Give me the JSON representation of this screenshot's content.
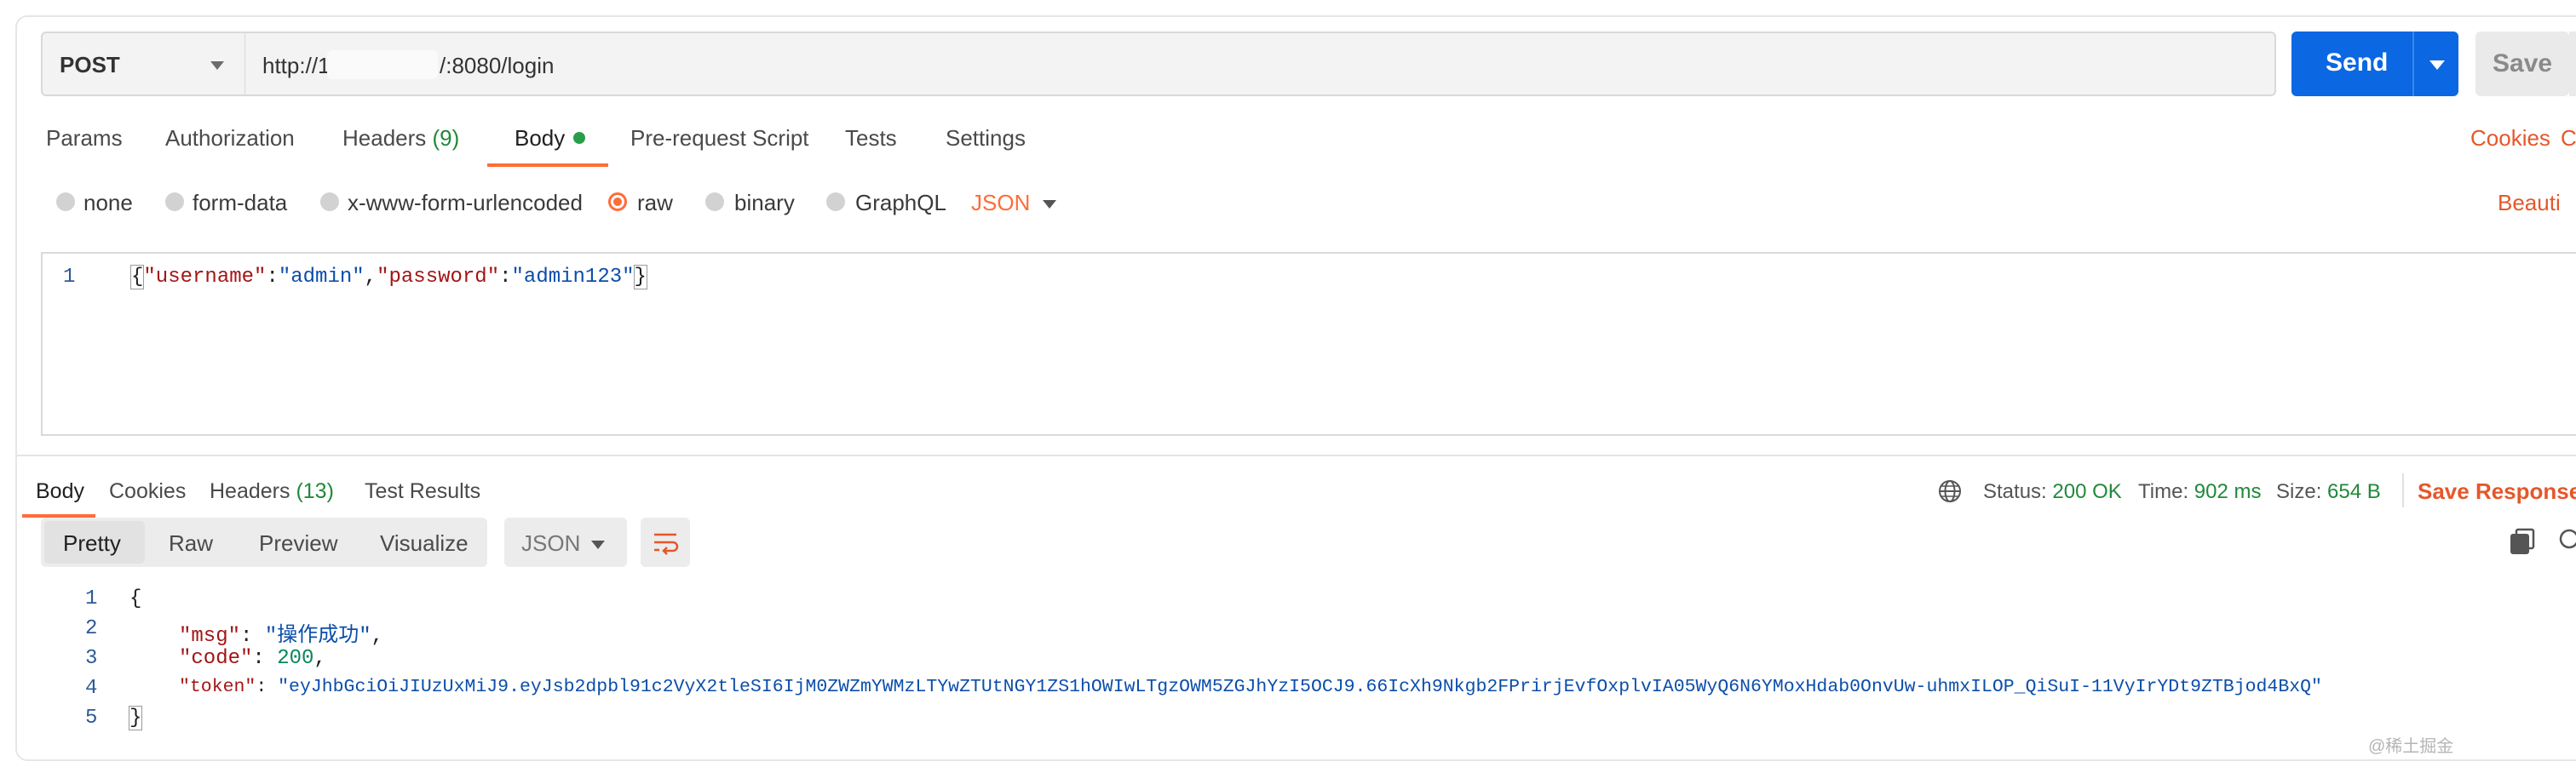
{
  "request": {
    "method": "POST",
    "url_prefix": "http://1",
    "url_suffix": "/:8080/login",
    "send_label": "Send",
    "save_label": "Save"
  },
  "request_tabs": [
    {
      "label": "Params"
    },
    {
      "label": "Authorization"
    },
    {
      "label": "Headers",
      "count": "(9)"
    },
    {
      "label": "Body"
    },
    {
      "label": "Pre-request Script"
    },
    {
      "label": "Tests"
    },
    {
      "label": "Settings"
    }
  ],
  "right_links": {
    "cookies": "Cookies",
    "code_partial": "Co",
    "beautify_partial": "Beauti"
  },
  "body_types": [
    "none",
    "form-data",
    "x-www-form-urlencoded",
    "raw",
    "binary",
    "GraphQL"
  ],
  "body_type_selected": "raw",
  "body_format": "JSON",
  "request_body": {
    "line_number": "1",
    "open": "{",
    "k1": "\"username\"",
    "colon1": ":",
    "v1": "\"admin\"",
    "comma": ",",
    "k2": "\"password\"",
    "colon2": ":",
    "v2": "\"admin123\"",
    "close": "}"
  },
  "response_tabs": [
    {
      "label": "Body"
    },
    {
      "label": "Cookies"
    },
    {
      "label": "Headers",
      "count": "(13)"
    },
    {
      "label": "Test Results"
    }
  ],
  "response_meta": {
    "status_label": "Status:",
    "status_value": "200 OK",
    "time_label": "Time:",
    "time_value": "902 ms",
    "size_label": "Size:",
    "size_value": "654 B",
    "save_response": "Save Response"
  },
  "view_modes": [
    "Pretty",
    "Raw",
    "Preview",
    "Visualize"
  ],
  "response_format": "JSON",
  "response_body": {
    "line_numbers": [
      "1",
      "2",
      "3",
      "4",
      "5"
    ],
    "open": "{",
    "msg_key": "\"msg\"",
    "msg_value": "\"操作成功\"",
    "code_key": "\"code\"",
    "code_value": "200",
    "token_key": "\"token\"",
    "token_value": "\"eyJhbGciOiJIUzUxMiJ9.eyJsb2dpbl91c2VyX2tleSI6IjM0ZWZmYWMzLTYwZTUtNGY1ZS1hOWIwLTgzOWM5ZGJhYzI5OCJ9.66IcXh9Nkgb2FPrirjEvfOxplvIA05WyQ6N6YMoxHdab0OnvUw-uhmxILOP_QiSuI-11VyIrYDt9ZTBjod4BxQ\"",
    "close": "}"
  },
  "watermark": "@稀土掘金"
}
